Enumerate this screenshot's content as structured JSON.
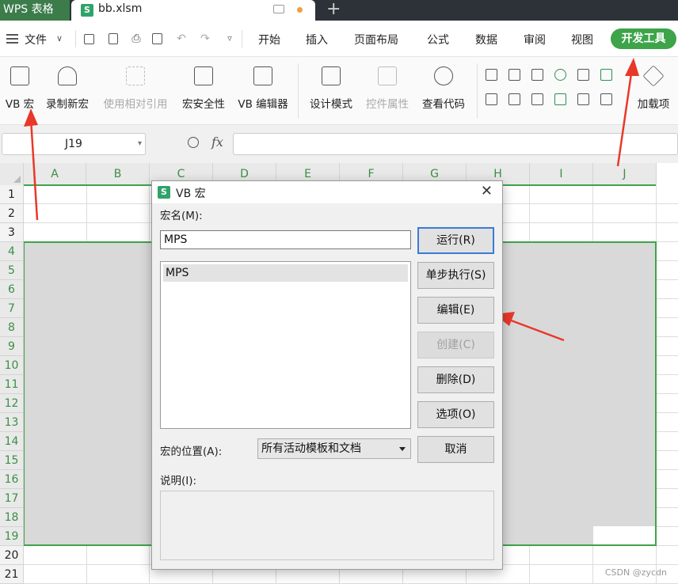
{
  "titlebar": {
    "app_tab": "WPS 表格",
    "file_name": "bb.xlsm"
  },
  "menubar": {
    "file_label": "文件",
    "tabs": [
      "开始",
      "插入",
      "页面布局",
      "公式",
      "数据",
      "审阅",
      "视图"
    ],
    "active_tab": "开发工具"
  },
  "ribbon": {
    "buttons": [
      {
        "label": "VB 宏",
        "icon": "vb-macro-icon",
        "enabled": true
      },
      {
        "label": "录制新宏",
        "icon": "record-macro-icon",
        "enabled": true
      },
      {
        "label": "使用相对引用",
        "icon": "relative-ref-icon",
        "enabled": false
      },
      {
        "label": "宏安全性",
        "icon": "macro-security-icon",
        "enabled": true
      },
      {
        "label": "VB 编辑器",
        "icon": "vb-editor-icon",
        "enabled": true
      },
      {
        "label": "设计模式",
        "icon": "design-mode-icon",
        "enabled": true
      },
      {
        "label": "控件属性",
        "icon": "control-properties-icon",
        "enabled": false
      },
      {
        "label": "查看代码",
        "icon": "view-code-icon",
        "enabled": true
      },
      {
        "label": "加载项",
        "icon": "addins-icon",
        "enabled": true
      }
    ]
  },
  "formula_bar": {
    "cell_ref": "J19",
    "formula": ""
  },
  "grid": {
    "columns": [
      "A",
      "B",
      "C",
      "D",
      "E",
      "F",
      "G",
      "H",
      "I",
      "J"
    ],
    "rows": [
      "1",
      "2",
      "3",
      "4",
      "5",
      "6",
      "7",
      "8",
      "9",
      "10",
      "11",
      "12",
      "13",
      "14",
      "15",
      "16",
      "17",
      "18",
      "19",
      "20",
      "21"
    ]
  },
  "dialog": {
    "title": "VB 宏",
    "macro_name_label": "宏名(M):",
    "macro_name_value": "MPS",
    "macro_list": [
      "MPS"
    ],
    "buttons": {
      "run": "运行(R)",
      "step": "单步执行(S)",
      "edit": "编辑(E)",
      "create": "创建(C)",
      "delete": "删除(D)",
      "options": "选项(O)",
      "cancel": "取消"
    },
    "location_label": "宏的位置(A):",
    "location_value": "所有活动模板和文档",
    "description_label": "说明(I):"
  },
  "watermark": "CSDN @zycdn",
  "colors": {
    "accent_green": "#3da449",
    "annotation_red": "#e8382a",
    "titlebar_dark": "#2d3238"
  }
}
